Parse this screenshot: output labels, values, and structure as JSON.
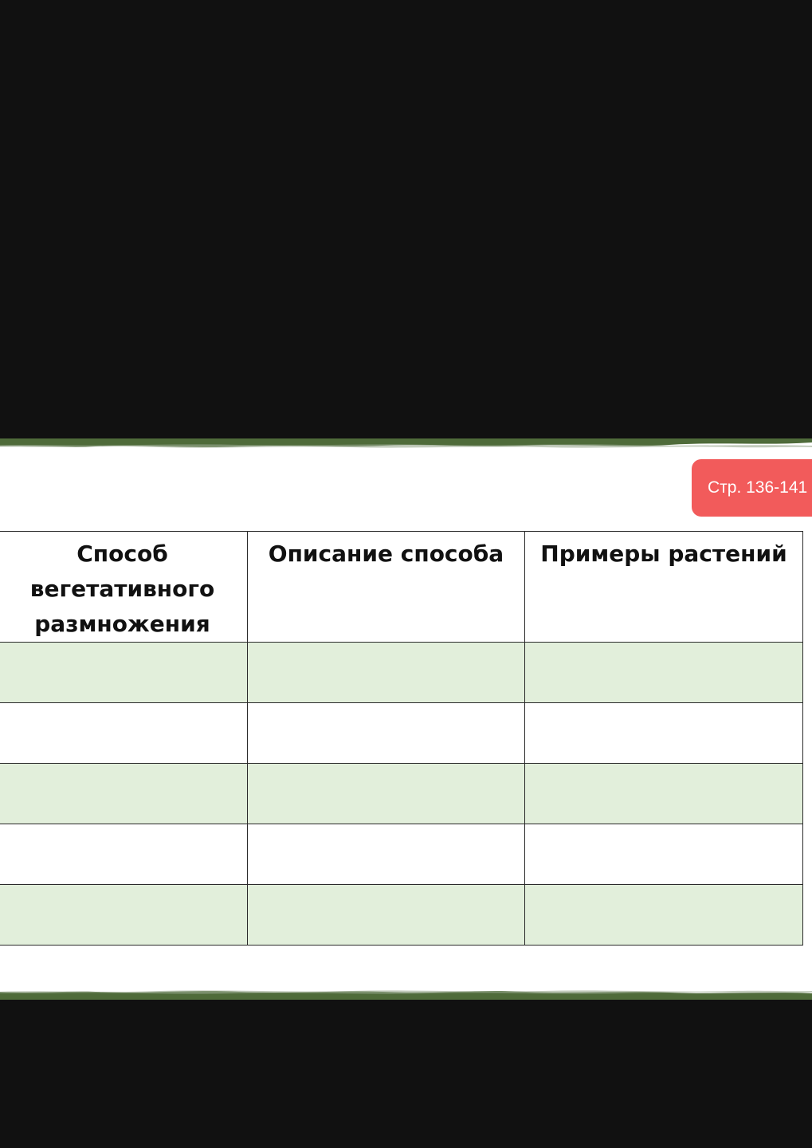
{
  "page_badge": {
    "label": "Стр. 136-141",
    "color": "#f25b5b"
  },
  "table": {
    "headers": [
      "Способ вегетативного размножения",
      "Описание способа",
      "Примеры растений"
    ],
    "rows": [
      [
        "",
        "",
        ""
      ],
      [
        "",
        "",
        ""
      ],
      [
        "",
        "",
        ""
      ],
      [
        "",
        "",
        ""
      ],
      [
        "",
        "",
        ""
      ]
    ],
    "row_colors": [
      "#e2efdb",
      "#ffffff",
      "#e2efdb",
      "#ffffff",
      "#e2efdb"
    ]
  },
  "colors": {
    "background": "#111111",
    "slide": "#ffffff",
    "edge_green": "#4f6b3a"
  }
}
